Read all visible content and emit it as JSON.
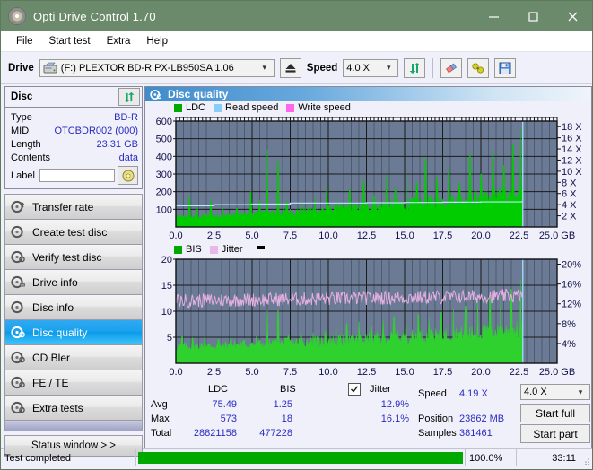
{
  "window": {
    "title": "Opti Drive Control 1.70",
    "icon": "disc-icon",
    "minimize": "minimize-icon",
    "maximize": "maximize-icon",
    "close": "close-icon"
  },
  "menu": {
    "items": [
      "File",
      "Start test",
      "Extra",
      "Help"
    ]
  },
  "toolbar": {
    "drive_label": "Drive",
    "drive_value": "(F:)   PLEXTOR BD-R  PX-LB950SA 1.06",
    "eject_icon": "eject-icon",
    "speed_label": "Speed",
    "speed_value": "4.0 X",
    "refresh_icon": "refresh-icon",
    "eraser_icon": "eraser-icon",
    "plug_icon": "plug-icon",
    "save_icon": "save-disk-icon"
  },
  "disc": {
    "title": "Disc",
    "refresh_icon": "refresh-icon",
    "rows": [
      {
        "key": "Type",
        "value": "BD-R"
      },
      {
        "key": "MID",
        "value": "OTCBDR002 (000)"
      },
      {
        "key": "Length",
        "value": "23.31 GB"
      },
      {
        "key": "Contents",
        "value": "data"
      }
    ],
    "label_key": "Label",
    "label_value": "",
    "label_button_icon": "cd-icon"
  },
  "nav": {
    "items": [
      {
        "label": "Transfer rate",
        "icon": "disc-test-icon",
        "selected": false
      },
      {
        "label": "Create test disc",
        "icon": "disc-burn-icon",
        "selected": false
      },
      {
        "label": "Verify test disc",
        "icon": "disc-verify-icon",
        "selected": false
      },
      {
        "label": "Drive info",
        "icon": "disc-drive-icon",
        "selected": false
      },
      {
        "label": "Disc info",
        "icon": "disc-info-icon",
        "selected": false
      },
      {
        "label": "Disc quality",
        "icon": "disc-quality-icon",
        "selected": true
      },
      {
        "label": "CD Bler",
        "icon": "disc-bler-icon",
        "selected": false
      },
      {
        "label": "FE / TE",
        "icon": "disc-fete-icon",
        "selected": false
      },
      {
        "label": "Extra tests",
        "icon": "disc-extra-icon",
        "selected": false
      }
    ],
    "status_window": "Status window > >"
  },
  "panel": {
    "title": "Disc quality",
    "icon": "disc-quality-icon"
  },
  "chart_data": [
    {
      "type": "line",
      "name": "ldc-chart",
      "title": "",
      "legend": [
        {
          "label": "LDC",
          "color": "#00a800"
        },
        {
          "label": "Read speed",
          "color": "#87cefa"
        },
        {
          "label": "Write speed",
          "color": "#ff66ee"
        }
      ],
      "legend_position": "top-left",
      "xlabel": "GB",
      "x_ticks": [
        "0.0",
        "2.5",
        "5.0",
        "7.5",
        "10.0",
        "12.5",
        "15.0",
        "17.5",
        "20.0",
        "22.5",
        "25.0 GB"
      ],
      "xlim": [
        0,
        25
      ],
      "ylabel_left": "LDC",
      "y_ticks_left": [
        "600",
        "500",
        "400",
        "300",
        "200",
        "100"
      ],
      "ylim_left": [
        0,
        600
      ],
      "ylabel_right": "Speed",
      "y_ticks_right": [
        "18 X",
        "16 X",
        "14 X",
        "12 X",
        "10 X",
        "8 X",
        "6 X",
        "4 X",
        "2 X"
      ],
      "ylim_right": [
        0,
        19
      ],
      "grid": true,
      "plot_bg": "#6b7a95",
      "series": [
        {
          "name": "LDC",
          "color": "#00cc00",
          "render": "spiky-area",
          "baseline_start": 55,
          "baseline_end": 185,
          "spike_peaks": [
            {
              "x": 0.9,
              "y": 170
            },
            {
              "x": 1.4,
              "y": 120
            },
            {
              "x": 2.3,
              "y": 150
            },
            {
              "x": 3.1,
              "y": 110
            },
            {
              "x": 4.0,
              "y": 105
            },
            {
              "x": 4.9,
              "y": 200
            },
            {
              "x": 5.5,
              "y": 150
            },
            {
              "x": 6.0,
              "y": 440
            },
            {
              "x": 6.7,
              "y": 370
            },
            {
              "x": 7.3,
              "y": 145
            },
            {
              "x": 8.2,
              "y": 135
            },
            {
              "x": 9.1,
              "y": 165
            },
            {
              "x": 9.9,
              "y": 230
            },
            {
              "x": 10.6,
              "y": 150
            },
            {
              "x": 11.4,
              "y": 210
            },
            {
              "x": 12.3,
              "y": 260
            },
            {
              "x": 13.0,
              "y": 180
            },
            {
              "x": 13.8,
              "y": 295
            },
            {
              "x": 14.4,
              "y": 215
            },
            {
              "x": 15.1,
              "y": 330
            },
            {
              "x": 15.8,
              "y": 250
            },
            {
              "x": 16.4,
              "y": 390
            },
            {
              "x": 17.1,
              "y": 280
            },
            {
              "x": 17.9,
              "y": 330
            },
            {
              "x": 18.6,
              "y": 250
            },
            {
              "x": 19.3,
              "y": 410
            },
            {
              "x": 20.0,
              "y": 300
            },
            {
              "x": 20.8,
              "y": 440
            },
            {
              "x": 21.5,
              "y": 350
            },
            {
              "x": 22.1,
              "y": 470
            },
            {
              "x": 22.6,
              "y": 560
            }
          ]
        },
        {
          "name": "Read speed",
          "color": "#b8e8ff",
          "render": "step-line",
          "points": [
            {
              "x": 0.0,
              "y": 3.8
            },
            {
              "x": 2.5,
              "y": 4.0
            },
            {
              "x": 5.0,
              "y": 4.1
            },
            {
              "x": 7.5,
              "y": 4.3
            },
            {
              "x": 10.0,
              "y": 4.3
            },
            {
              "x": 12.5,
              "y": 4.35
            },
            {
              "x": 15.0,
              "y": 4.4
            },
            {
              "x": 17.5,
              "y": 4.45
            },
            {
              "x": 20.0,
              "y": 4.5
            },
            {
              "x": 22.7,
              "y": 4.55
            }
          ]
        },
        {
          "name": "end-marker",
          "color": "#9fd8f5",
          "render": "vertical-line",
          "x": 22.75
        }
      ]
    },
    {
      "type": "line",
      "name": "bis-jitter-chart",
      "title": "",
      "legend": [
        {
          "label": "BIS",
          "color": "#00a800"
        },
        {
          "label": "Jitter",
          "color": "#e8b8e8"
        }
      ],
      "legend_position": "top-left",
      "xlabel": "GB",
      "x_ticks": [
        "0.0",
        "2.5",
        "5.0",
        "7.5",
        "10.0",
        "12.5",
        "15.0",
        "17.5",
        "20.0",
        "22.5",
        "25.0 GB"
      ],
      "xlim": [
        0,
        25
      ],
      "ylabel_left": "BIS",
      "y_ticks_left": [
        "20",
        "15",
        "10",
        "5"
      ],
      "ylim_left": [
        0,
        20
      ],
      "ylabel_right": "Jitter",
      "y_ticks_right": [
        "20%",
        "16%",
        "12%",
        "8%",
        "4%"
      ],
      "ylim_right": [
        0,
        21
      ],
      "grid": true,
      "plot_bg": "#6b7a95",
      "series": [
        {
          "name": "BIS",
          "color": "#2fd12f",
          "render": "spiky-area",
          "baseline_start": 3.2,
          "baseline_end": 6.4,
          "spike_peaks": [
            {
              "x": 0.4,
              "y": 5.2
            },
            {
              "x": 1.1,
              "y": 4.9
            },
            {
              "x": 1.9,
              "y": 5.0
            },
            {
              "x": 2.8,
              "y": 4.6
            },
            {
              "x": 3.6,
              "y": 4.9
            },
            {
              "x": 4.5,
              "y": 4.7
            },
            {
              "x": 5.3,
              "y": 5.1
            },
            {
              "x": 6.0,
              "y": 10.2
            },
            {
              "x": 6.7,
              "y": 10.1
            },
            {
              "x": 7.4,
              "y": 5.3
            },
            {
              "x": 8.2,
              "y": 5.6
            },
            {
              "x": 9.0,
              "y": 5.9
            },
            {
              "x": 9.8,
              "y": 6.1
            },
            {
              "x": 10.5,
              "y": 9.1
            },
            {
              "x": 11.2,
              "y": 7.6
            },
            {
              "x": 12.0,
              "y": 8.0
            },
            {
              "x": 12.8,
              "y": 7.2
            },
            {
              "x": 13.6,
              "y": 8.4
            },
            {
              "x": 14.3,
              "y": 9.0
            },
            {
              "x": 15.1,
              "y": 8.2
            },
            {
              "x": 15.9,
              "y": 9.4
            },
            {
              "x": 16.6,
              "y": 8.8
            },
            {
              "x": 17.4,
              "y": 9.8
            },
            {
              "x": 18.2,
              "y": 10.4
            },
            {
              "x": 19.0,
              "y": 11.0
            },
            {
              "x": 19.8,
              "y": 11.8
            },
            {
              "x": 20.6,
              "y": 12.4
            },
            {
              "x": 21.3,
              "y": 13.0
            },
            {
              "x": 22.0,
              "y": 14.2
            },
            {
              "x": 22.6,
              "y": 16.2
            }
          ]
        },
        {
          "name": "Jitter",
          "color": "#e3afe0",
          "render": "noisy-line",
          "mean_start": 12.6,
          "mean_end": 13.6,
          "noise": 1.4
        },
        {
          "name": "end-marker",
          "color": "#9fd8f5",
          "render": "vertical-line",
          "x": 22.75
        }
      ],
      "marker": {
        "name": "cursor-marker",
        "color": "#000000",
        "x": 11.0
      }
    }
  ],
  "stats": {
    "columns": [
      "LDC",
      "BIS"
    ],
    "jitter_label": "Jitter",
    "jitter_checked": true,
    "rows": [
      {
        "name": "Avg",
        "ldc": "75.49",
        "bis": "1.25",
        "jitter": "12.9%"
      },
      {
        "name": "Max",
        "ldc": "573",
        "bis": "18",
        "jitter": "16.1%"
      },
      {
        "name": "Total",
        "ldc": "28821158",
        "bis": "477228",
        "jitter": ""
      }
    ]
  },
  "controls": {
    "speed_label": "Speed",
    "speed_value": "4.19 X",
    "speed_select": "4.0 X",
    "position_label": "Position",
    "position_value": "23862 MB",
    "samples_label": "Samples",
    "samples_value": "381461",
    "start_full": "Start full",
    "start_part": "Start part"
  },
  "statusbar": {
    "message": "Test completed",
    "progress_text": "100.0%",
    "progress_value": 100,
    "elapsed": "33:11"
  },
  "colors": {
    "titlebar": "#6b8a6b",
    "accent_blue": "#2b2bc0",
    "selection": "#18a2ef",
    "progress": "#00a800",
    "plot_bg": "#6b7a95",
    "ldc_green": "#00cc00",
    "jitter_pink": "#e3afe0"
  }
}
